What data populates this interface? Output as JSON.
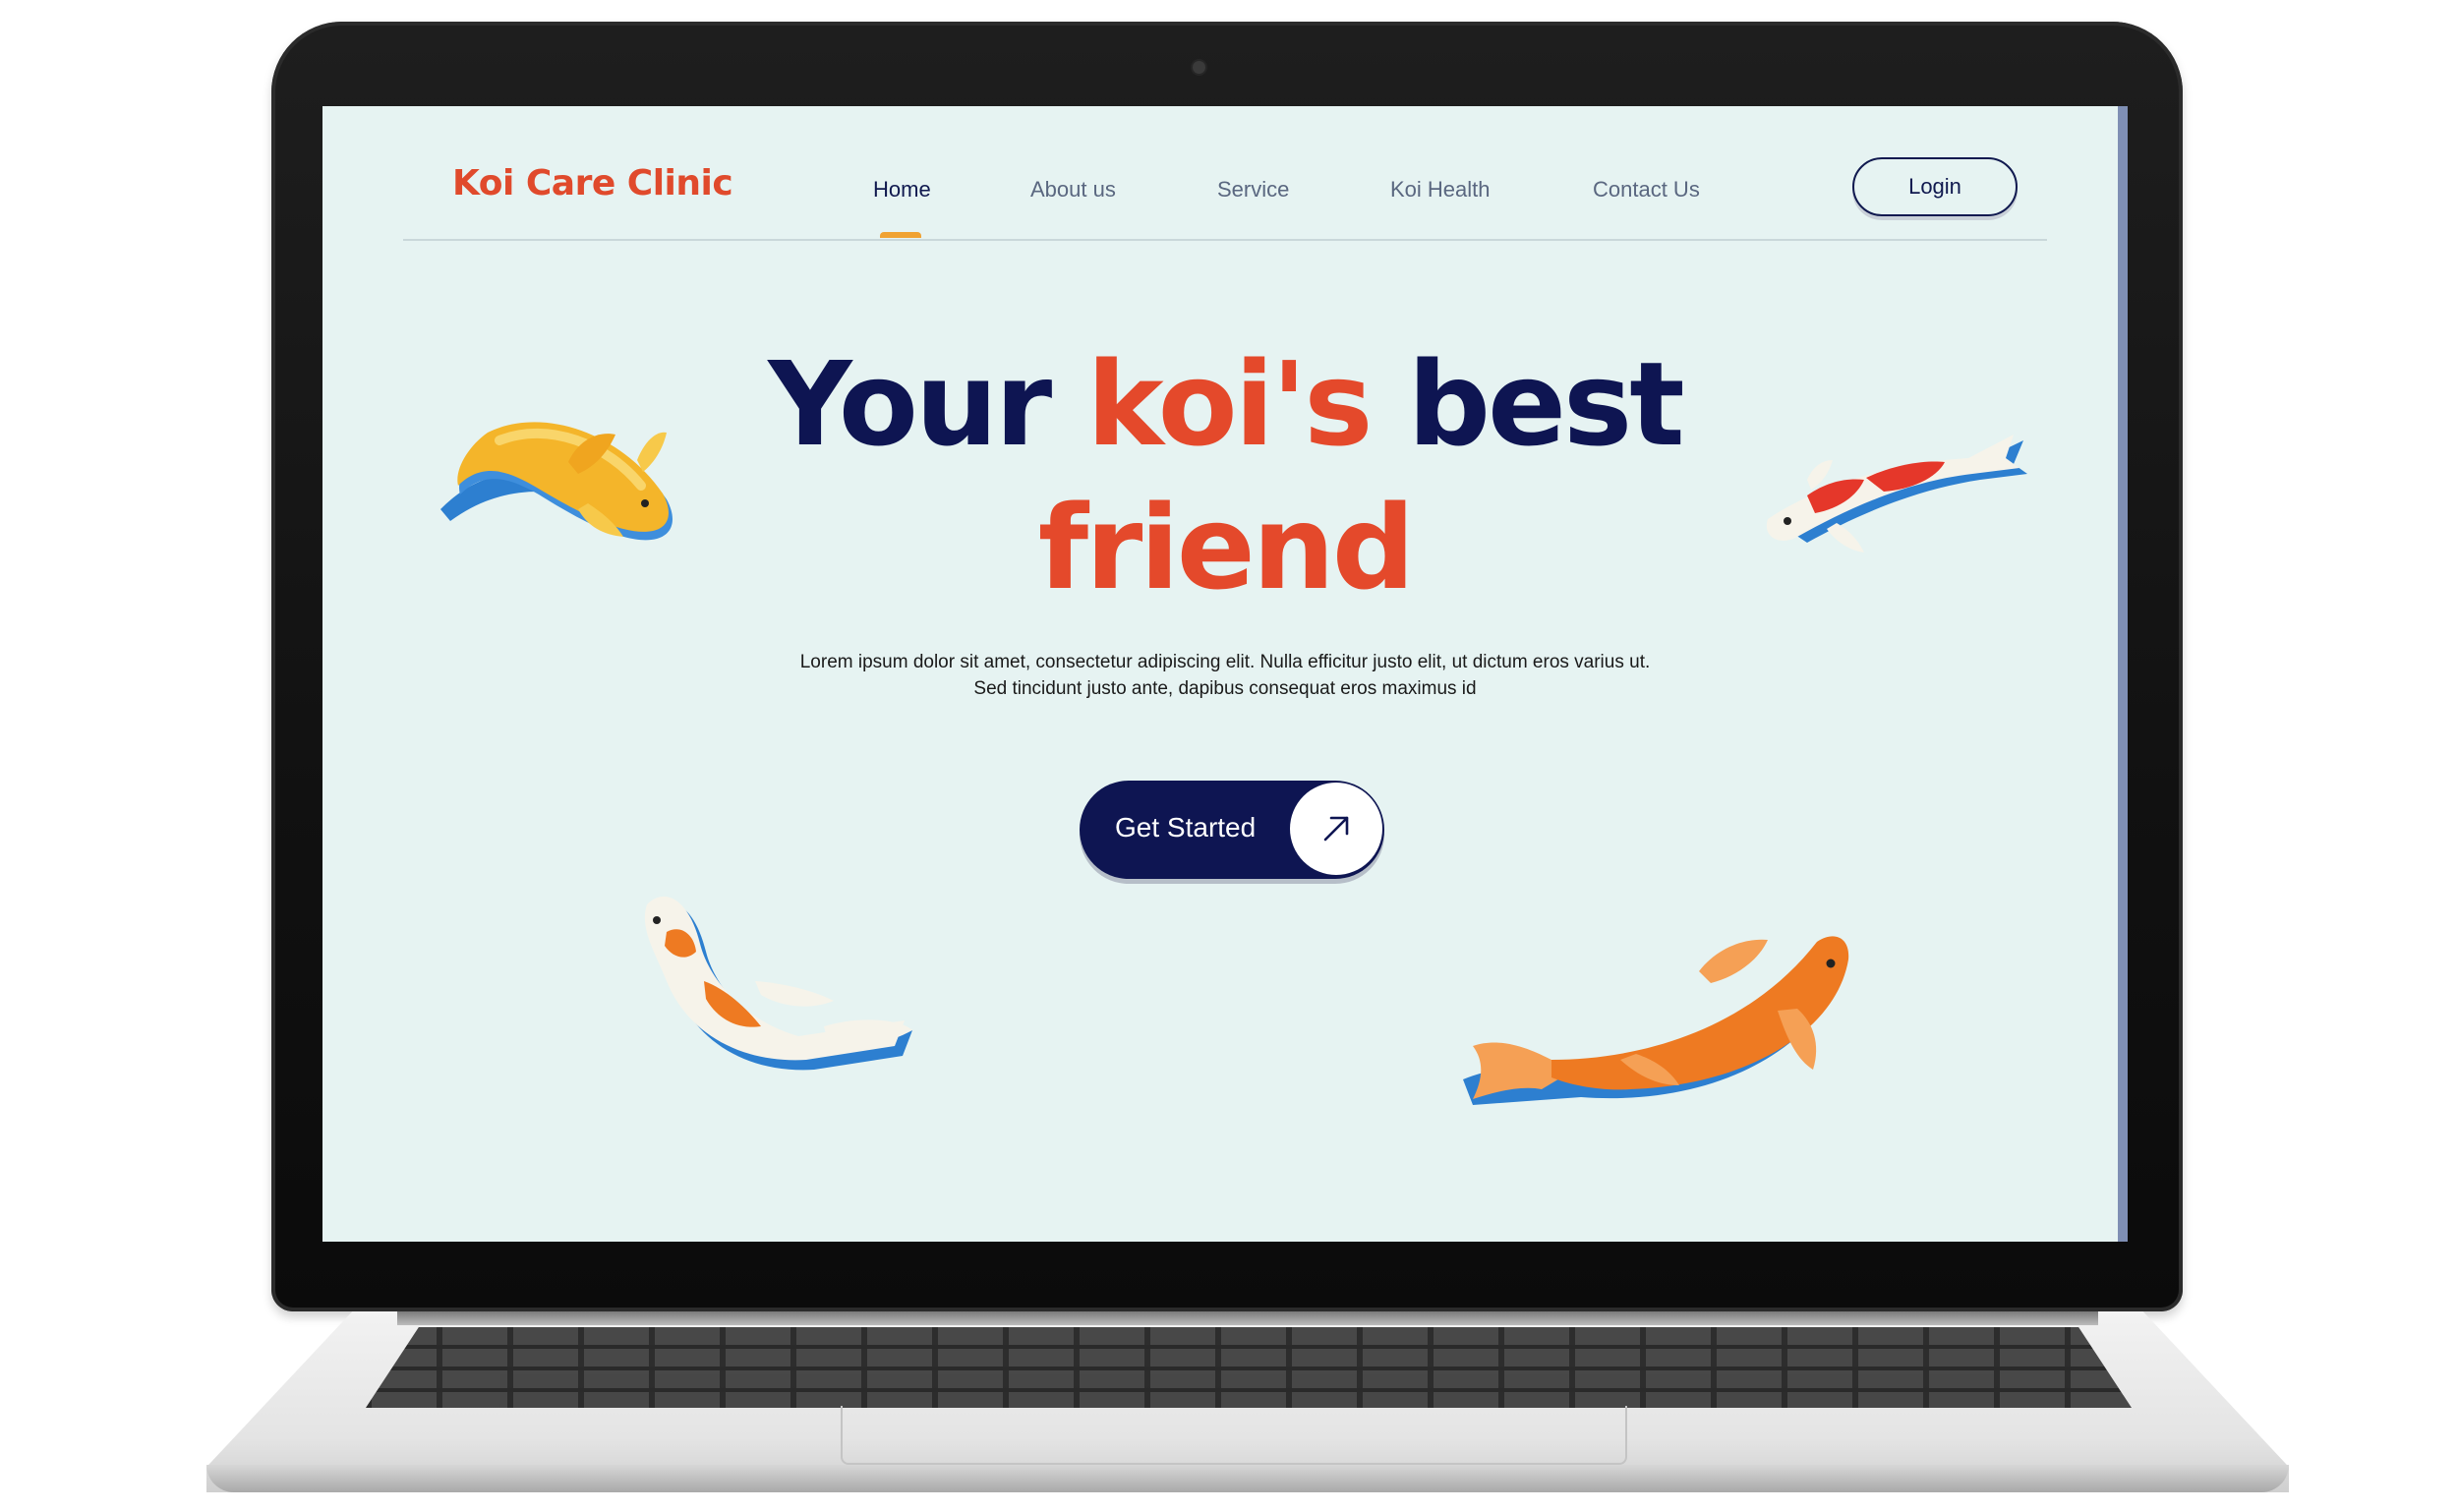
{
  "nav": {
    "logo": "Koi Care Clinic",
    "links": [
      {
        "label": "Home",
        "active": true
      },
      {
        "label": "About us",
        "active": false
      },
      {
        "label": "Service",
        "active": false
      },
      {
        "label": "Koi Health",
        "active": false
      },
      {
        "label": "Contact Us",
        "active": false
      }
    ],
    "login_label": "Login"
  },
  "hero": {
    "title_part1": "Your",
    "title_accent": "koi's",
    "title_part2": "best",
    "title_line2": "friend",
    "description_line1": "Lorem ipsum dolor sit amet, consectetur adipiscing elit. Nulla efficitur justo elit, ut dictum eros varius ut.",
    "description_line2": "Sed tincidunt justo ante, dapibus consequat eros maximus id",
    "cta_label": "Get Started",
    "cta_icon": "arrow-up-right-icon"
  },
  "colors": {
    "background": "#e6f3f2",
    "navy": "#0e1552",
    "accent": "#e4492b",
    "underline": "#f0a232"
  },
  "decorations": [
    "yellow-koi-icon",
    "red-white-koi-icon",
    "orange-white-koi-icon",
    "orange-koi-icon"
  ]
}
